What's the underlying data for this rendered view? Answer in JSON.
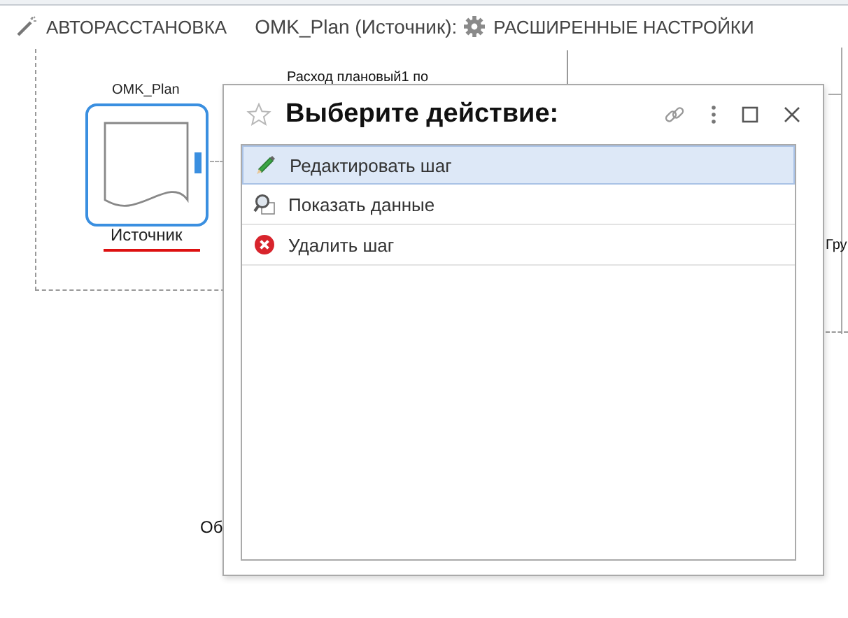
{
  "toolbar": {
    "autolayout_button": {
      "label": "АВТОРАССТАНОВКА"
    },
    "context_label": "OMK_Plan (Источник):",
    "settings_button": {
      "label": "РАСШИРЕННЫЕ НАСТРОЙКИ"
    }
  },
  "canvas": {
    "node": {
      "title": "OMK_Plan",
      "caption": "Источник",
      "selected": true
    },
    "labels": [
      "Расход плановый1 по",
      "Гру",
      "Об"
    ]
  },
  "dialog": {
    "title": "Выберите действие:",
    "actions": [
      {
        "label": "Редактировать шаг",
        "kind": "edit",
        "selected": true
      },
      {
        "label": "Показать данные",
        "kind": "view",
        "selected": false
      },
      {
        "label": "Удалить шаг",
        "kind": "delete",
        "selected": false
      }
    ]
  }
}
